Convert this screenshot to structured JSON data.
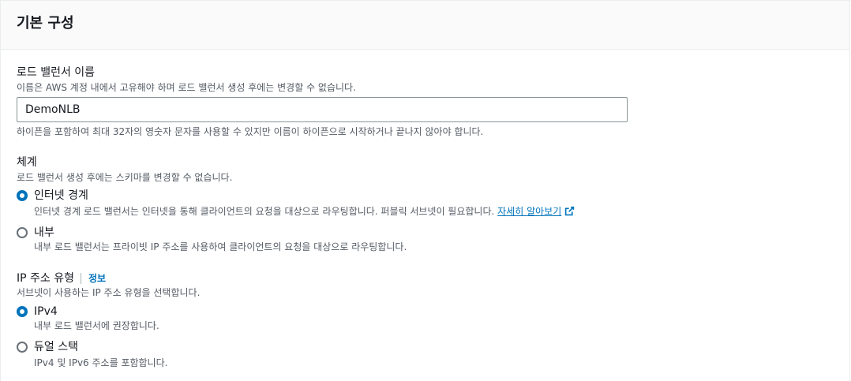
{
  "panel": {
    "title": "기본 구성"
  },
  "name_field": {
    "label": "로드 밸런서 이름",
    "description": "이름은 AWS 계정 내에서 고유해야 하며 로드 밸런서 생성 후에는 변경할 수 없습니다.",
    "value": "DemoNLB",
    "constraint": "하이픈을 포함하여 최대 32자의 영숫자 문자를 사용할 수 있지만 이름이 하이픈으로 시작하거나 끝나지 않아야 합니다."
  },
  "scheme": {
    "label": "체계",
    "description": "로드 밸런서 생성 후에는 스키마를 변경할 수 없습니다.",
    "options": [
      {
        "label": "인터넷 경계",
        "description": "인터넷 경계 로드 밸런서는 인터넷을 통해 클라이언트의 요청을 대상으로 라우팅합니다. 퍼블릭 서브넷이 필요합니다.",
        "link_text": "자세히 알아보기",
        "link_icon": "external-link-icon",
        "selected": true
      },
      {
        "label": "내부",
        "description": "내부 로드 밸런서는 프라이빗 IP 주소를 사용하여 클라이언트의 요청을 대상으로 라우팅합니다.",
        "selected": false
      }
    ]
  },
  "ip_type": {
    "label": "IP 주소 유형",
    "info_link": "정보",
    "description": "서브넷이 사용하는 IP 주소 유형을 선택합니다.",
    "options": [
      {
        "label": "IPv4",
        "description": "내부 로드 밸런서에 권장합니다.",
        "selected": true
      },
      {
        "label": "듀얼 스택",
        "description": "IPv4 및 IPv6 주소를 포함합니다.",
        "selected": false
      }
    ]
  },
  "colors": {
    "accent": "#0073bb",
    "text": "#16191f",
    "secondary_text": "#545b64",
    "header_bg": "#fafafa"
  }
}
